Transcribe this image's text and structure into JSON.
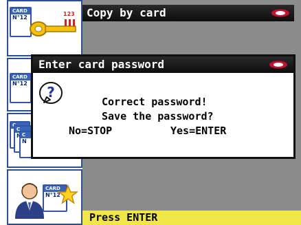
{
  "window": {
    "title": "Copy by card",
    "brand_color": "#c8102e"
  },
  "dialog": {
    "title": "Enter card password",
    "line1": "Correct password!",
    "line2": "Save the password?",
    "no_option": "No=STOP",
    "yes_option": "Yes=ENTER",
    "icon": "question-icon"
  },
  "sidebar": {
    "card_label": "CARD",
    "card_number": "N°12",
    "key_digits": "123",
    "items": [
      {
        "name": "copy-by-card",
        "icon": "card-key-icon"
      },
      {
        "name": "card-item-2",
        "icon": "card-icon"
      },
      {
        "name": "card-stack",
        "icon": "card-stack-icon"
      },
      {
        "name": "user-card-favorite",
        "icon": "user-card-star-icon"
      }
    ]
  },
  "status": {
    "text": "Press ENTER"
  }
}
